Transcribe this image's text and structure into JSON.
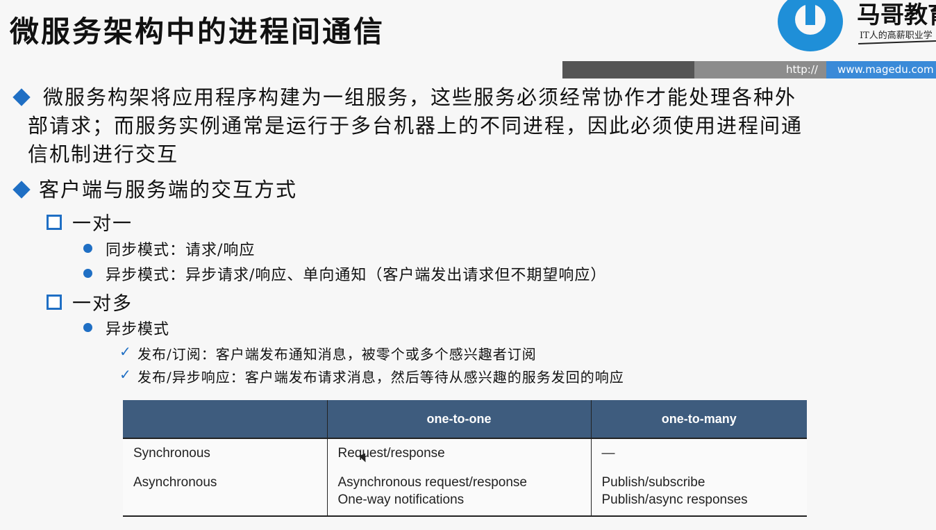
{
  "title": "微服务架构中的进程间通信",
  "brand": {
    "name": "马哥教育",
    "slogan": "IT人的高薪职业学",
    "http": "http://",
    "url": "www.magedu.com"
  },
  "bullets": {
    "b1": {
      "line1": "微服务构架将应用程序构建为一组服务，这些服务必须经常协作才能处理各种外",
      "line2": "部请求；而服务实例通常是运行于多台机器上的不同进程，因此必须使用进程间通",
      "line3": "信机制进行交互"
    },
    "b2": "客户端与服务端的交互方式",
    "one_to_one": "一对一",
    "sync_mode": "同步模式：请求/响应",
    "async_mode": "异步模式：异步请求/响应、单向通知（客户端发出请求但不期望响应）",
    "one_to_many": "一对多",
    "async_mode2": "异步模式",
    "pubsub": "发布/订阅：客户端发布通知消息，被零个或多个感兴趣者订阅",
    "pubasync": "发布/异步响应：客户端发布请求消息，然后等待从感兴趣的服务发回的响应"
  },
  "table": {
    "headers": [
      "",
      "one-to-one",
      "one-to-many"
    ],
    "rows": [
      {
        "label": "Synchronous",
        "one": "Request/response",
        "many": "—"
      },
      {
        "label": "Asynchronous",
        "one1": "Asynchronous request/response",
        "one2": "One-way notifications",
        "many1": "Publish/subscribe",
        "many2": "Publish/async responses"
      }
    ]
  },
  "colors": {
    "accent": "#1f6fc4",
    "table_header": "#3e5c7e",
    "logo": "#1f8fd8"
  }
}
